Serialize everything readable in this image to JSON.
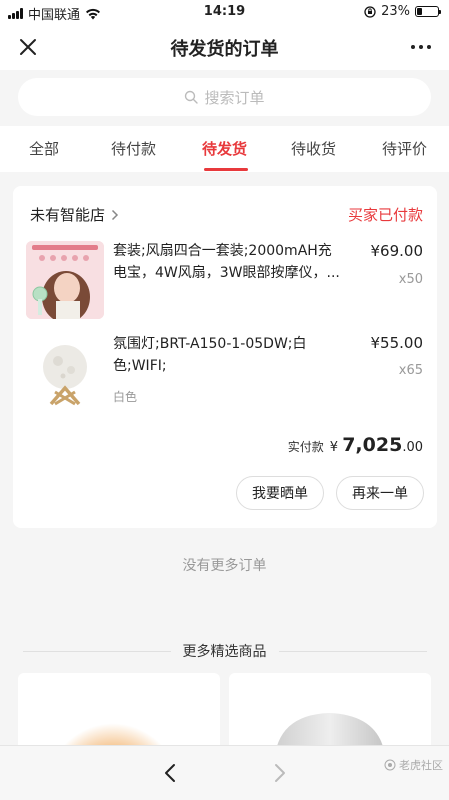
{
  "status_bar": {
    "carrier": "中国联通",
    "time": "14:19",
    "battery": "23%",
    "battery_level": 0.23
  },
  "nav": {
    "title": "待发货的订单"
  },
  "search": {
    "placeholder": "搜索订单"
  },
  "tabs": [
    {
      "label": "全部"
    },
    {
      "label": "待付款"
    },
    {
      "label": "待发货",
      "active": true
    },
    {
      "label": "待收货"
    },
    {
      "label": "待评价"
    }
  ],
  "order": {
    "store": "未有智能店",
    "status": "买家已付款",
    "items": [
      {
        "title": "套装;风扇四合一套装;2000mAH充电宝，4W风扇，3W眼部按摩仪，...",
        "line1": "套装;风扇四合一套装;2000mAH充",
        "line2": "电宝，4W风扇，3W眼部按摩仪，...",
        "price": "¥69.00",
        "qty": "x50"
      },
      {
        "title": "氛围灯;BRT-A150-1-05DW;白色;WIFI;",
        "line1": "氛围灯;BRT-A150-1-05DW;白",
        "line2": "色;WIFI;",
        "spec": "白色",
        "price": "¥55.00",
        "qty": "x65"
      }
    ],
    "paid_label": "实付款",
    "paid_currency": "¥",
    "paid_int": "7,025",
    "paid_dec": ".00",
    "buttons": {
      "share": "我要晒单",
      "reorder": "再来一单"
    }
  },
  "no_more": "没有更多订单",
  "more_section": {
    "title": "更多精选商品"
  },
  "watermark": "老虎社区"
}
